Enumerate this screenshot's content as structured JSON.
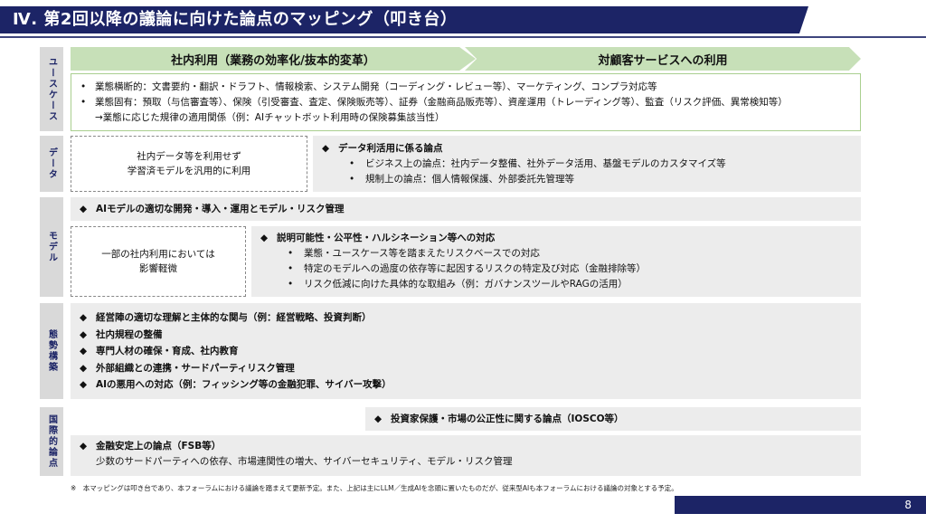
{
  "title": "Ⅳ. 第2回以降の議論に向けた論点のマッピング（叩き台）",
  "side_labels": {
    "usecase": "ユースケース",
    "data": "データ",
    "model": "モデル",
    "governance": "態勢構築",
    "international": "国際的論点"
  },
  "headers": {
    "internal": "社内利用（業務の効率化/抜本的変革）",
    "customer": "対顧客サービスへの利用"
  },
  "usecase": {
    "bullet": "•",
    "line1": "業態横断的：文書要約・翻訳・ドラフト、情報検索、システム開発（コーディング・レビュー等）、マーケティング、コンプラ対応等",
    "line2": "業態固有：預取（与信審査等）、保険（引受審査、査定、保険販売等）、証券（金融商品販売等）、資産運用（トレーディング等）、監査（リスク評価、異常検知等）",
    "line3": "→業態に応じた規律の適用関係（例：AIチャットボット利用時の保険募集該当性）"
  },
  "data_section": {
    "left_line1": "社内データ等を利用せず",
    "left_line2": "学習済モデルを汎用的に利用",
    "heading": "データ利活用に係る論点",
    "items": [
      "ビジネス上の論点：社内データ整備、社外データ活用、基盤モデルのカスタマイズ等",
      "規制上の論点：個人情報保護、外部委託先管理等"
    ]
  },
  "model_section": {
    "top_heading": "AIモデルの適切な開発・導入・運用とモデル・リスク管理",
    "left_line1": "一部の社内利用においては",
    "left_line2": "影響軽微",
    "heading": "説明可能性・公平性・ハルシネーション等への対応",
    "items": [
      "業態・ユースケース等を踏まえたリスクベースでの対応",
      "特定のモデルへの過度の依存等に起因するリスクの特定及び対応（金融排除等）",
      "リスク低減に向けた具体的な取組み（例：ガバナンスツールやRAGの活用）"
    ]
  },
  "governance": {
    "items": [
      "経営陣の適切な理解と主体的な関与（例：経営戦略、投資判断）",
      "社内規程の整備",
      "専門人材の確保・育成、社内教育",
      "外部組織との連携・サードパーティリスク管理",
      "AIの悪用への対応（例：フィッシング等の金融犯罪、サイバー攻撃）"
    ]
  },
  "international": {
    "iosco": "投資家保護・市場の公正性に関する論点（IOSCO等）",
    "fsb": "金融安定上の論点（FSB等）",
    "fsb_detail": "少数のサードパーティへの依存、市場連関性の増大、サイバーセキュリティ、モデル・リスク管理"
  },
  "diamond": "◆",
  "sub_bullet": "•",
  "footnote": "※　本マッピングは叩き台であり、本フォーラムにおける議論を踏まえて更新予定。また、上記は主にLLM／生成AIを念頭に置いたものだが、従来型AIも本フォーラムにおける議論の対象とする予定。",
  "page_number": "8"
}
